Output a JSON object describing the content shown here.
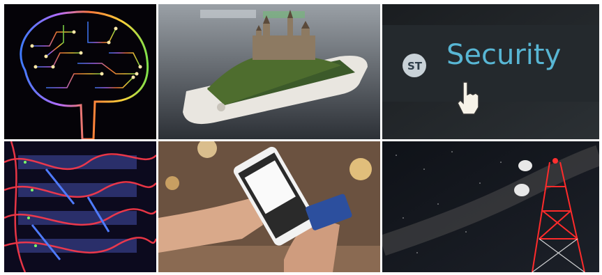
{
  "images": [
    {
      "subject": "circuit-brain",
      "text": ""
    },
    {
      "subject": "castle-on-smartphone",
      "text": ""
    },
    {
      "subject": "security-screen",
      "text": "Security",
      "logo_text": "ST"
    },
    {
      "subject": "server-cables",
      "text": ""
    },
    {
      "subject": "mobile-payment",
      "text": ""
    },
    {
      "subject": "telecom-tower-night",
      "text": ""
    }
  ],
  "colors": {
    "background": "#ffffff",
    "security_text": "#58b6d4",
    "tower_red": "#e02020"
  }
}
